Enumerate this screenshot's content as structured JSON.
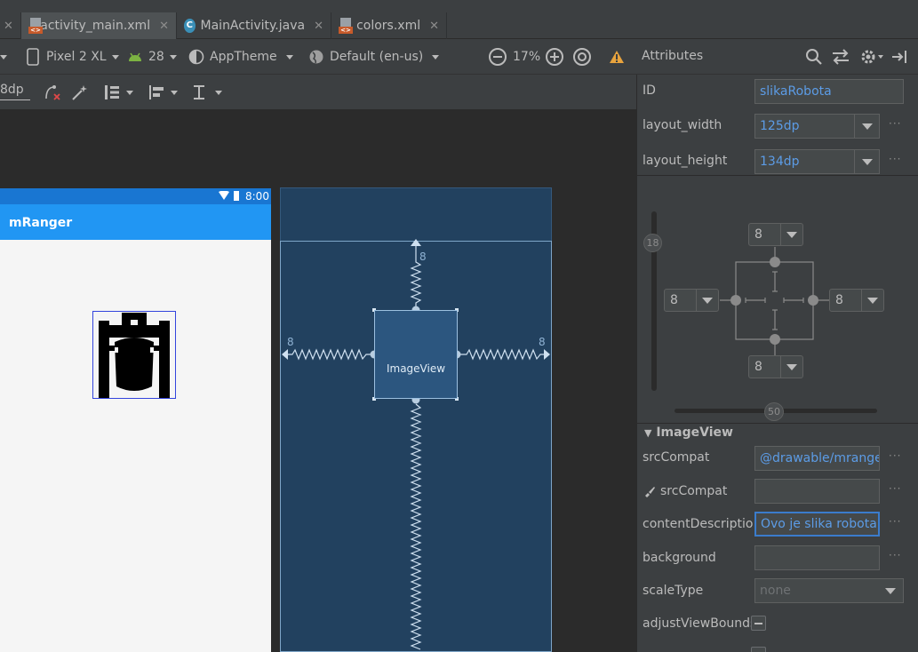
{
  "tabs": [
    {
      "label": "activity_main.xml",
      "icon": "xml-file-icon",
      "active": true
    },
    {
      "label": "MainActivity.java",
      "icon": "java-class-icon",
      "active": false
    },
    {
      "label": "colors.xml",
      "icon": "xml-file-icon",
      "active": false
    }
  ],
  "toolbar": {
    "device": "Pixel 2 XL",
    "api": "28",
    "theme": "AppTheme",
    "locale": "Default (en-us)",
    "zoom": "17%",
    "margin_value": "8dp"
  },
  "device_preview": {
    "status_time": "8:00",
    "app_title": "mRanger"
  },
  "blueprint": {
    "view_label": "ImageView",
    "margin_top": "8",
    "margin_left": "8",
    "margin_right": "8"
  },
  "attributes": {
    "panel_title": "Attributes",
    "id_label": "ID",
    "id_value": "slikaRobota",
    "layout_width_label": "layout_width",
    "layout_width_value": "125dp",
    "layout_height_label": "layout_height",
    "layout_height_value": "134dp",
    "vertical_bias": "18",
    "horizontal_bias": "50",
    "constraint_top": "8",
    "constraint_left": "8",
    "constraint_right": "8",
    "constraint_bottom": "8",
    "section_title": "ImageView",
    "srccompat_label": "srcCompat",
    "srccompat_value": "@drawable/mranger",
    "srccompat_tools_label": "srcCompat",
    "srccompat_tools_value": "",
    "content_desc_label": "contentDescriptio",
    "content_desc_value": "Ovo je slika robota",
    "background_label": "background",
    "background_value": "",
    "scaletype_label": "scaleType",
    "scaletype_value": "none",
    "adjust_label": "adjustViewBounds",
    "dots": "···"
  },
  "colors": {
    "ide_bg": "#2b2b2b",
    "panel_bg": "#3c3f41",
    "accent_value": "#5c9ce6",
    "app_bar": "#2196f3",
    "blueprint_bg": "#22415f"
  }
}
